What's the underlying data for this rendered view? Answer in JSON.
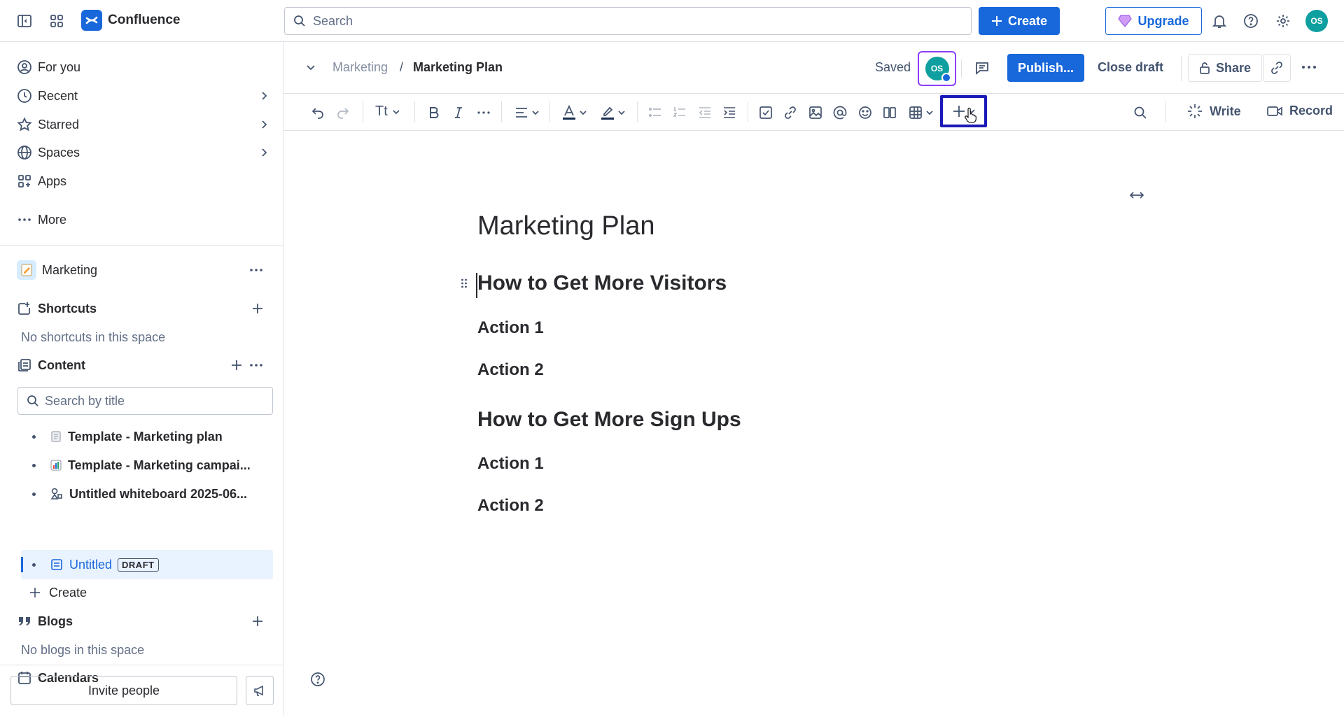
{
  "topnav": {
    "app_name": "Confluence",
    "search_placeholder": "Search",
    "create_label": "Create",
    "upgrade_label": "Upgrade",
    "user_initials": "OS"
  },
  "sidebar": {
    "nav": [
      {
        "label": "For you",
        "icon": "user-circle-icon"
      },
      {
        "label": "Recent",
        "icon": "clock-icon"
      },
      {
        "label": "Starred",
        "icon": "star-icon"
      },
      {
        "label": "Spaces",
        "icon": "globe-icon"
      },
      {
        "label": "Apps",
        "icon": "apps-icon"
      },
      {
        "label": "More",
        "icon": "more-icon"
      }
    ],
    "space_name": "Marketing",
    "shortcuts_label": "Shortcuts",
    "shortcuts_empty": "No shortcuts in this space",
    "content_label": "Content",
    "search_placeholder": "Search by title",
    "tree": [
      {
        "label": "Template - Marketing plan"
      },
      {
        "label": "Template - Marketing campai..."
      },
      {
        "label": "Untitled whiteboard 2025-06..."
      },
      {
        "label": "Untitled",
        "badge": "DRAFT"
      }
    ],
    "create_label": "Create",
    "blogs_label": "Blogs",
    "blogs_empty": "No blogs in this space",
    "calendars_label": "Calendars",
    "invite_label": "Invite people"
  },
  "header": {
    "breadcrumb_parent": "Marketing",
    "breadcrumb_sep": "/",
    "breadcrumb_current": "Marketing Plan",
    "saved_label": "Saved",
    "avatar_initials": "OS",
    "publish_label": "Publish...",
    "close_draft_label": "Close draft",
    "share_label": "Share"
  },
  "toolbar": {
    "text_style_label": "Tt",
    "write_label": "Write",
    "record_label": "Record"
  },
  "editor": {
    "title": "Marketing Plan",
    "blocks": [
      {
        "level": "h1",
        "text": "How to Get More Visitors"
      },
      {
        "level": "h3",
        "text": "Action 1"
      },
      {
        "level": "h3",
        "text": "Action 2"
      },
      {
        "level": "h1",
        "text": "How to Get More Sign Ups"
      },
      {
        "level": "h3",
        "text": "Action 1"
      },
      {
        "level": "h3",
        "text": "Action 2"
      }
    ]
  },
  "colors": {
    "brand": "#1868db",
    "highlight_border": "#1a1ab8",
    "avatar_ring": "#8a3ffc",
    "selected_bg": "#e9f2ff"
  }
}
